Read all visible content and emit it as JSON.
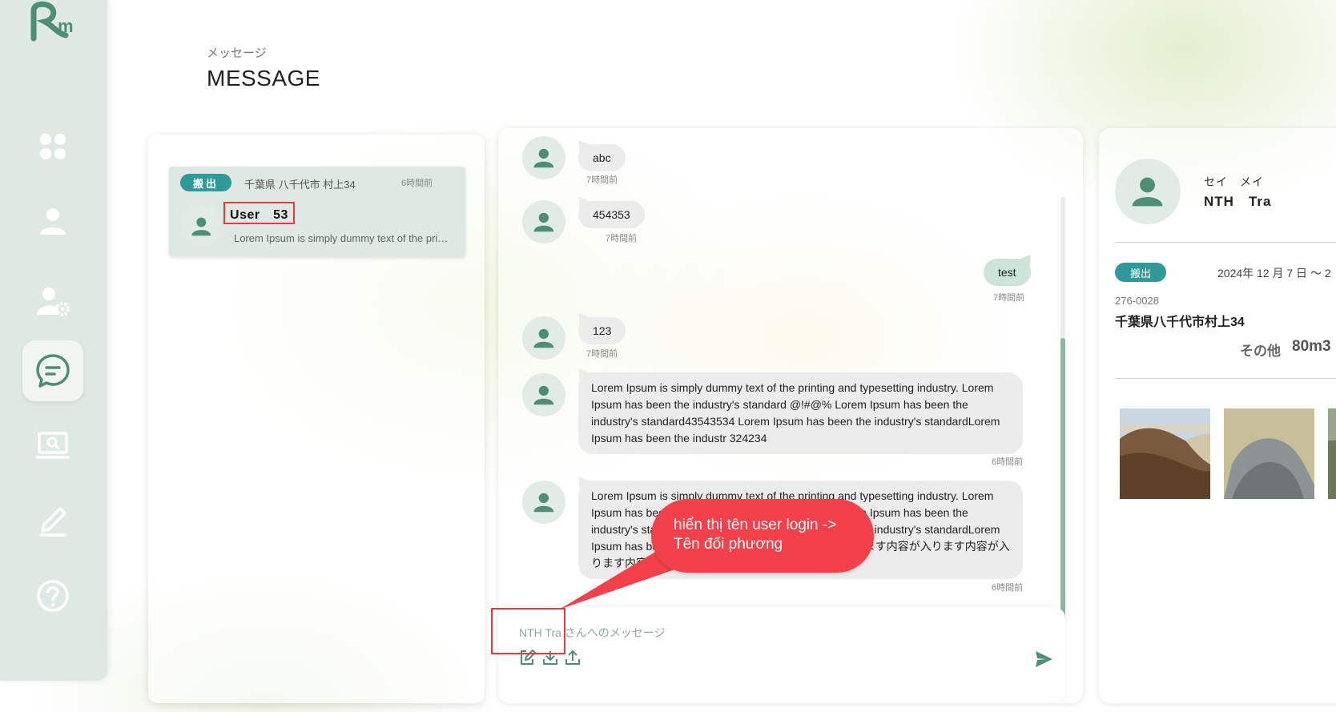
{
  "sidebar": {
    "logo_text": "Rm",
    "items": [
      {
        "name": "dashboard",
        "icon": "dashboard-icon"
      },
      {
        "name": "users",
        "icon": "user-icon"
      },
      {
        "name": "user-settings",
        "icon": "user-settings-icon"
      },
      {
        "name": "messages",
        "icon": "chat-icon",
        "active": true
      },
      {
        "name": "monitor",
        "icon": "monitor-search-icon"
      },
      {
        "name": "edit",
        "icon": "pen-icon"
      },
      {
        "name": "help",
        "icon": "help-icon"
      }
    ]
  },
  "header": {
    "subtitle": "メッセージ",
    "title": "MESSAGE"
  },
  "conversations": [
    {
      "badge": "搬出",
      "address": "千葉県 八千代市 村上34",
      "time": "6時間前",
      "name": "User　53",
      "preview": "Lorem Ipsum is simply dummy text of the printing and typesetting industry."
    }
  ],
  "messages": [
    {
      "from": "other",
      "text": "abc",
      "time": "7時間前"
    },
    {
      "from": "other",
      "text": "454353",
      "time": "7時間前"
    },
    {
      "from": "me",
      "text": "test",
      "time": "7時間前"
    },
    {
      "from": "other",
      "text": "123",
      "time": "7時間前"
    },
    {
      "from": "other",
      "text": "Lorem Ipsum is simply dummy text of the printing and typesetting industry. Lorem Ipsum has been the industry's standard @!#@% Lorem Ipsum has been the industry's standard43543534 Lorem Ipsum has been the industry's standardLorem Ipsum has been the industr 324234",
      "time": "6時間前"
    },
    {
      "from": "other",
      "text": "Lorem Ipsum is simply dummy text of the printing and typesetting industry. Lorem Ipsum has been the industry's standard @!#@% Lorem Ipsum has been the industry's standard43543534 Lorem Ipsum has been the industry's standardLorem Ipsum has been the industr 内容が入ります内容が入ります内容が入ります内容が入ります内容が入ります内容が入ります。",
      "time": "6時間前"
    }
  ],
  "composer": {
    "placeholder": "NTH Tra さんへのメッセージ",
    "tools": [
      "edit-icon",
      "download-icon",
      "upload-icon"
    ],
    "send_icon": "send-icon"
  },
  "annotation": {
    "text": "hiển thị tên user login -> Tên đối phương"
  },
  "details": {
    "kana": "セイ　メイ",
    "name": "NTH　Tra",
    "badge": "搬出",
    "date": "2024年 12 月 7 日 ～ 2",
    "zip": "276-0028",
    "address": "千葉県八千代市村上34",
    "category": "その他",
    "volume": "80m3",
    "photos": [
      "soil-photo",
      "gravel-photo",
      "partial-photo"
    ]
  },
  "colors": {
    "accent": "#2f9a99",
    "icon_green": "#4e8f73",
    "rail_bg": "#dfe9e3",
    "annotation_red": "#f2414a"
  }
}
